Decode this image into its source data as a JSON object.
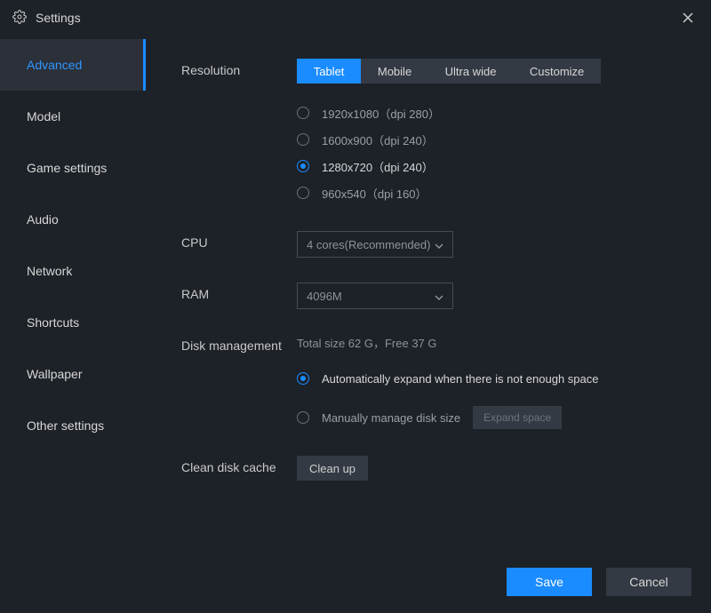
{
  "window": {
    "title": "Settings"
  },
  "sidebar": {
    "items": [
      {
        "label": "Advanced"
      },
      {
        "label": "Model"
      },
      {
        "label": "Game settings"
      },
      {
        "label": "Audio"
      },
      {
        "label": "Network"
      },
      {
        "label": "Shortcuts"
      },
      {
        "label": "Wallpaper"
      },
      {
        "label": "Other settings"
      }
    ],
    "active_index": 0
  },
  "resolution": {
    "label": "Resolution",
    "tabs": [
      "Tablet",
      "Mobile",
      "Ultra wide",
      "Customize"
    ],
    "active_tab": 0,
    "options": [
      "1920x1080（dpi 280）",
      "1600x900（dpi 240）",
      "1280x720（dpi 240）",
      "960x540（dpi 160）"
    ],
    "selected_option": 2
  },
  "cpu": {
    "label": "CPU",
    "value": "4 cores(Recommended)"
  },
  "ram": {
    "label": "RAM",
    "value": "4096M"
  },
  "disk": {
    "label": "Disk management",
    "info": "Total size 62 G，Free 37 G",
    "auto_label": "Automatically expand when there is not enough space",
    "manual_label": "Manually manage disk size",
    "expand_btn": "Expand space",
    "selected": "auto"
  },
  "clean": {
    "label": "Clean disk cache",
    "button": "Clean up"
  },
  "footer": {
    "save": "Save",
    "cancel": "Cancel"
  }
}
